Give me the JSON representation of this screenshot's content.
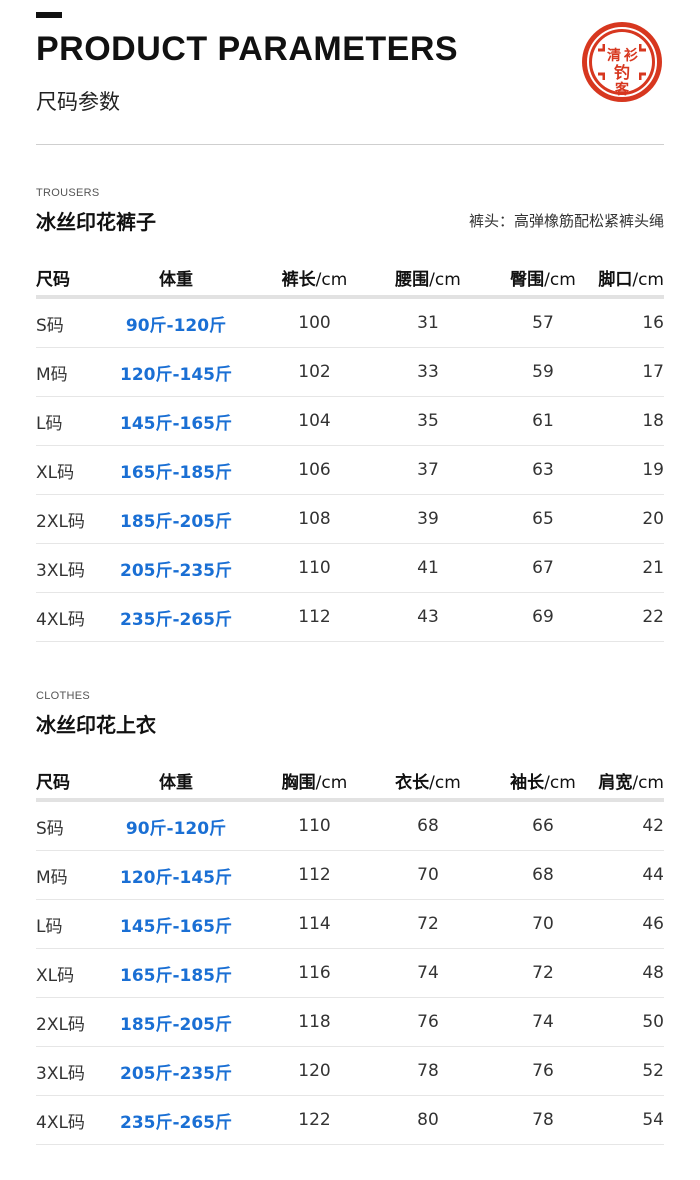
{
  "header": {
    "title": "PRODUCT PARAMETERS",
    "subtitle": "尺码参数",
    "logo_text": [
      "清",
      "衫",
      "钓",
      "客"
    ]
  },
  "colors": {
    "accent": "#1a6fd4",
    "seal": "#d7371f"
  },
  "trousers": {
    "eyebrow": "TROUSERS",
    "title": "冰丝印花裤子",
    "note": "裤头：高弹橡筋配松紧裤头绳",
    "headers": [
      {
        "bold": "尺码",
        "unit": ""
      },
      {
        "bold": "体重",
        "unit": ""
      },
      {
        "bold": "裤长",
        "unit": "/cm"
      },
      {
        "bold": "腰围",
        "unit": "/cm"
      },
      {
        "bold": "臀围",
        "unit": "/cm"
      },
      {
        "bold": "脚口",
        "unit": "/cm"
      }
    ],
    "rows": [
      [
        "S码",
        "90斤-120斤",
        "100",
        "31",
        "57",
        "16"
      ],
      [
        "M码",
        "120斤-145斤",
        "102",
        "33",
        "59",
        "17"
      ],
      [
        "L码",
        "145斤-165斤",
        "104",
        "35",
        "61",
        "18"
      ],
      [
        "XL码",
        "165斤-185斤",
        "106",
        "37",
        "63",
        "19"
      ],
      [
        "2XL码",
        "185斤-205斤",
        "108",
        "39",
        "65",
        "20"
      ],
      [
        "3XL码",
        "205斤-235斤",
        "110",
        "41",
        "67",
        "21"
      ],
      [
        "4XL码",
        "235斤-265斤",
        "112",
        "43",
        "69",
        "22"
      ]
    ]
  },
  "clothes": {
    "eyebrow": "CLOTHES",
    "title": "冰丝印花上衣",
    "headers": [
      {
        "bold": "尺码",
        "unit": ""
      },
      {
        "bold": "体重",
        "unit": ""
      },
      {
        "bold": "胸围",
        "unit": "/cm"
      },
      {
        "bold": "衣长",
        "unit": "/cm"
      },
      {
        "bold": "袖长",
        "unit": "/cm"
      },
      {
        "bold": "肩宽",
        "unit": "/cm"
      }
    ],
    "rows": [
      [
        "S码",
        "90斤-120斤",
        "110",
        "68",
        "66",
        "42"
      ],
      [
        "M码",
        "120斤-145斤",
        "112",
        "70",
        "68",
        "44"
      ],
      [
        "L码",
        "145斤-165斤",
        "114",
        "72",
        "70",
        "46"
      ],
      [
        "XL码",
        "165斤-185斤",
        "116",
        "74",
        "72",
        "48"
      ],
      [
        "2XL码",
        "185斤-205斤",
        "118",
        "76",
        "74",
        "50"
      ],
      [
        "3XL码",
        "205斤-235斤",
        "120",
        "78",
        "76",
        "52"
      ],
      [
        "4XL码",
        "235斤-265斤",
        "122",
        "80",
        "78",
        "54"
      ]
    ]
  }
}
